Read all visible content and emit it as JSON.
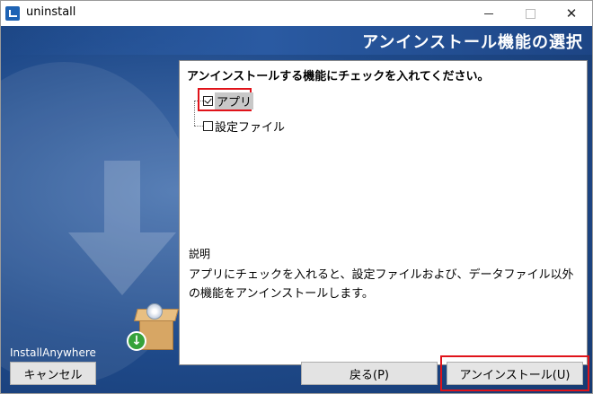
{
  "window": {
    "title": "uninstall",
    "app_icon": "installer-icon",
    "controls": [
      "minimize-icon",
      "maximize-icon",
      "close-icon"
    ]
  },
  "header": {
    "title": "アンインストール機能の選択"
  },
  "panel": {
    "instruction": "アンインストールする機能にチェックを入れてください。",
    "features": [
      {
        "label": "アプリ",
        "checked": true,
        "selected": true,
        "highlighted": true
      },
      {
        "label": "設定ファイル",
        "checked": false,
        "selected": false,
        "highlighted": false
      }
    ],
    "description_heading": "説明",
    "description_text": "アプリにチェックを入れると、設定ファイルおよび、データファイル以外の機能をアンインストールします。"
  },
  "branding": {
    "label": "InstallAnywhere"
  },
  "buttons": {
    "cancel": "キャンセル",
    "back": "戻る(P)",
    "uninstall": "アンインストール(U)"
  },
  "colors": {
    "accent_blue": "#1f4a8a",
    "highlight_red": "#e0131a"
  }
}
